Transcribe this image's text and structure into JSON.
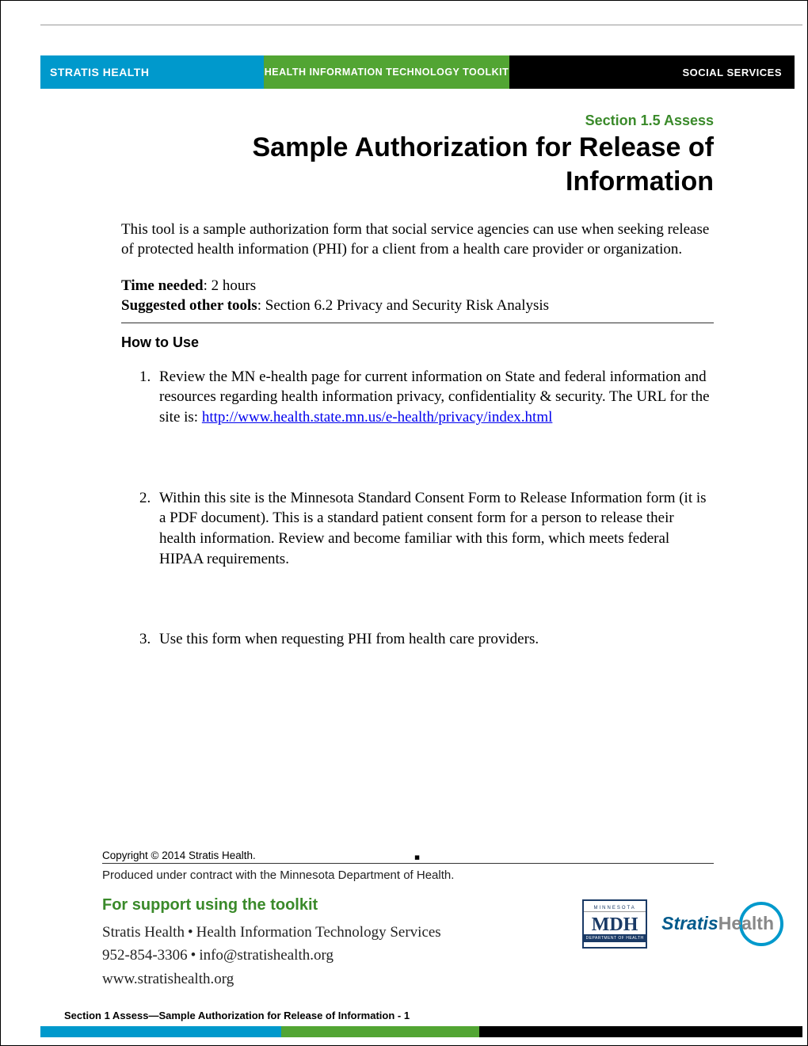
{
  "header": {
    "left": "STRATIS HEALTH",
    "mid": "HEALTH INFORMATION TECHNOLOGY TOOLKIT",
    "right": "SOCIAL SERVICES"
  },
  "section_label": "Section 1.5 Assess",
  "title": "Sample Authorization for Release of Information",
  "intro": "This tool is a sample authorization form that social service agencies can use when seeking release of protected health information (PHI) for a client from a health care provider or organization.",
  "meta": {
    "time_label": "Time needed",
    "time_value": ": 2 hours",
    "tools_label": "Suggested other tools",
    "tools_value": ": Section 6.2 Privacy and Security Risk Analysis"
  },
  "howto_heading": "How to Use",
  "steps": [
    {
      "pre": "Review the MN e-health page for current information on State and federal information and resources regarding health information privacy, confidentiality & security.  The URL for the site is: ",
      "link": "http://www.health.state.mn.us/e-health/privacy/index.html",
      "post": ""
    },
    {
      "pre": "Within this site is the Minnesota Standard Consent Form to Release Information form (it is a PDF document).  This is a standard patient consent form for a person to release their health information.  Review and become familiar with this form, which meets federal HIPAA requirements.",
      "link": "",
      "post": ""
    },
    {
      "pre": "Use this form when requesting PHI from health care providers.",
      "link": "",
      "post": ""
    }
  ],
  "footer": {
    "copyright": "Copyright © 2014 Stratis Health.",
    "produced": "Produced under contract with the Minnesota Department of Health.",
    "support_title": "For support using the toolkit",
    "support_line1a": "Stratis Health",
    "support_line1b": "Health Information Technology Services",
    "support_line2a": "952-854-3306",
    "support_line2b": "info@stratishealth.org",
    "support_line3": "www.stratishealth.org",
    "mdh_top": "MINNESOTA",
    "mdh_text": "MDH",
    "mdh_bottom": "DEPARTMENT OF HEALTH",
    "stratis_brand1": "Stratis",
    "stratis_brand2": "Health",
    "page_label": "Section 1 Assess—Sample Authorization for Release of Information - 1"
  }
}
